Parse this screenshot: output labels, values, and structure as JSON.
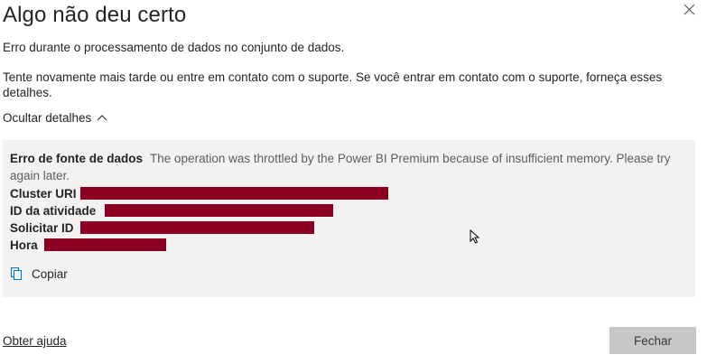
{
  "dialog": {
    "title": "Algo não deu certo",
    "message_primary": "Erro durante o processamento de dados no conjunto de dados.",
    "message_secondary": "Tente novamente mais tarde ou entre em contato com o suporte. Se você entrar em contato com o suporte, forneça esses detalhes.",
    "toggle_details_label": "Ocultar detalhes",
    "details": {
      "error_source_label": "Erro de fonte de dados",
      "error_source_value": "The operation was throttled by the Power BI Premium because of insufficient memory. Please try again later.",
      "cluster_uri_label": "Cluster URI",
      "activity_id_label": "ID da atividade",
      "request_id_label": "Solicitar ID",
      "time_label": "Hora",
      "redaction_color": "#8b0020"
    },
    "copy_label": "Copiar",
    "help_link_label": "Obter ajuda",
    "close_button_label": "Fechar"
  },
  "icons": {
    "close": "close-icon",
    "chevron": "chevron-up-icon",
    "copy": "copy-icon",
    "cursor": "mouse-cursor-icon"
  },
  "colors": {
    "background": "#ffffff",
    "details_background": "#f3f2f1",
    "button_disabled_bg": "#c8c6c4",
    "text_primary": "#252423",
    "text_secondary": "#605e5c",
    "accent_blue": "#0078d4"
  }
}
